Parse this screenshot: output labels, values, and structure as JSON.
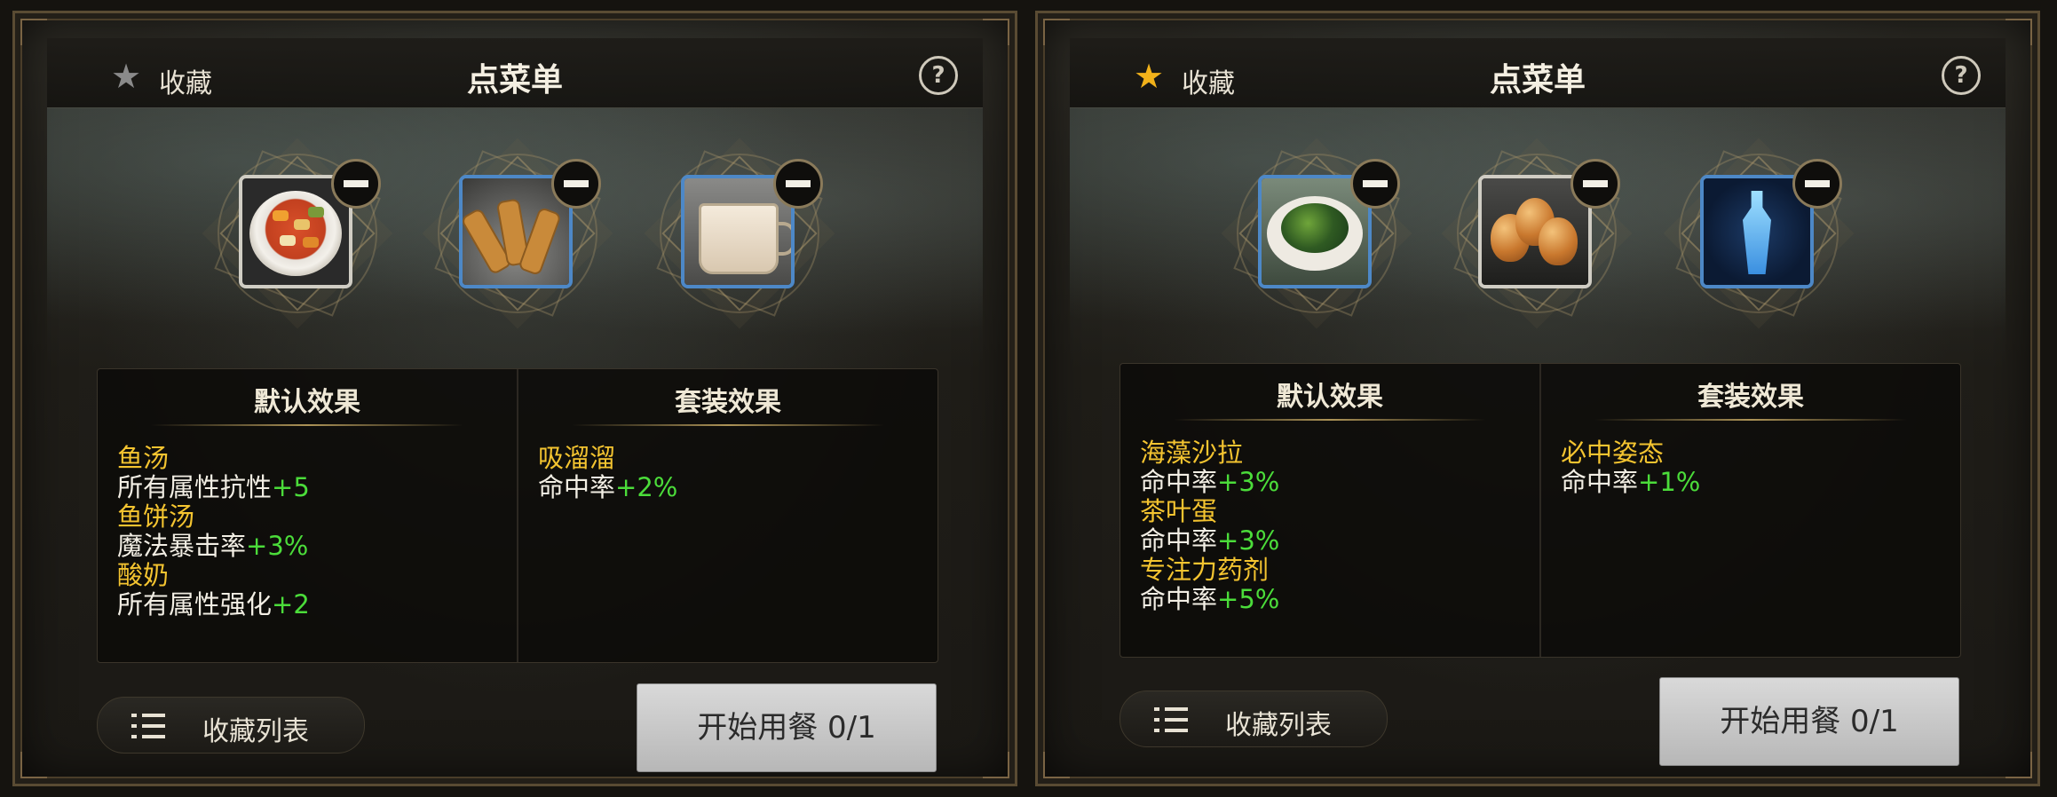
{
  "panels": [
    {
      "favorite_label": "收藏",
      "favorite_active": false,
      "title": "点菜单",
      "help_glyph": "?",
      "items": [
        {
          "icon": "fish-soup-icon"
        },
        {
          "icon": "fish-cake-soup-icon"
        },
        {
          "icon": "yogurt-icon"
        }
      ],
      "default_header": "默认效果",
      "set_header": "套装效果",
      "default_effects": [
        {
          "name": "鱼汤",
          "stat": "所有属性抗性",
          "value": "+5"
        },
        {
          "name": "鱼饼汤",
          "stat": "魔法暴击率",
          "value": "+3%"
        },
        {
          "name": "酸奶",
          "stat": "所有属性强化",
          "value": "+2"
        }
      ],
      "set_effects": [
        {
          "name": "吸溜溜",
          "stat": "命中率",
          "value": "+2%"
        }
      ],
      "fav_list_label": "收藏列表",
      "start_label": "开始用餐 0/1"
    },
    {
      "favorite_label": "收藏",
      "favorite_active": true,
      "title": "点菜单",
      "help_glyph": "?",
      "items": [
        {
          "icon": "seaweed-salad-icon"
        },
        {
          "icon": "tea-egg-icon"
        },
        {
          "icon": "focus-potion-icon"
        }
      ],
      "default_header": "默认效果",
      "set_header": "套装效果",
      "default_effects": [
        {
          "name": "海藻沙拉",
          "stat": "命中率",
          "value": "+3%"
        },
        {
          "name": "茶叶蛋",
          "stat": "命中率",
          "value": "+3%"
        },
        {
          "name": "专注力药剂",
          "stat": "命中率",
          "value": "+5%"
        }
      ],
      "set_effects": [
        {
          "name": "必中姿态",
          "stat": "命中率",
          "value": "+1%"
        }
      ],
      "fav_list_label": "收藏列表",
      "start_label": "开始用餐 0/1"
    }
  ],
  "colors": {
    "accent_gold": "#f4c430",
    "value_green": "#4bdc3a",
    "star_active": "#f2b21a",
    "star_inactive": "#8a8a8a"
  }
}
